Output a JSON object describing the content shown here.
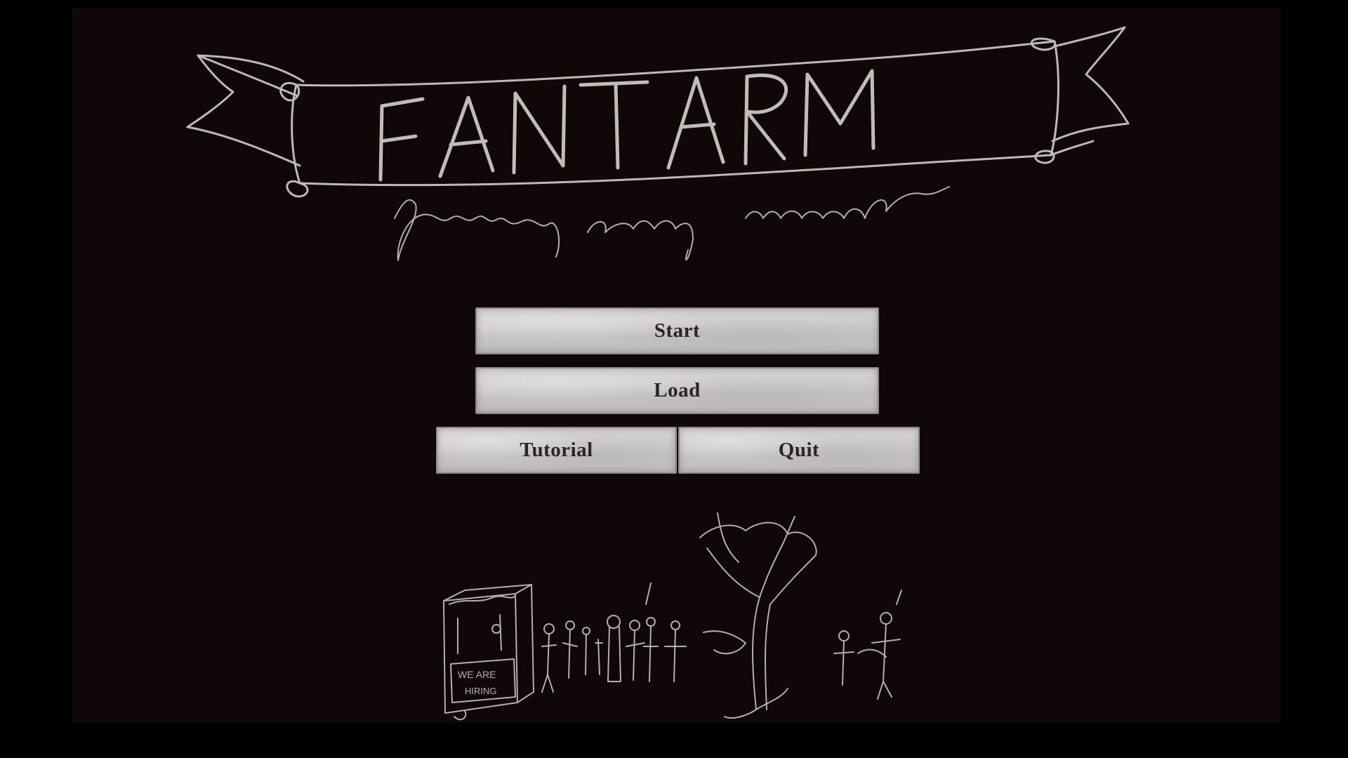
{
  "logo": {
    "title": "FANTARM",
    "subtitle": "fantasy army manager"
  },
  "menu": {
    "start_label": "Start",
    "load_label": "Load",
    "tutorial_label": "Tutorial",
    "quit_label": "Quit"
  },
  "scene": {
    "sign_text_line1": "WE ARE",
    "sign_text_line2": "HIRING"
  },
  "colors": {
    "background": "#0f0708",
    "letterbox": "#000000",
    "chalk": "#cfcdc9",
    "button_face": "#c9c8c6",
    "button_text": "#2a2626"
  },
  "icons": [
    "banner-logo",
    "recruitment-stall-icon",
    "tree-icon",
    "soldier-figures-icon"
  ]
}
